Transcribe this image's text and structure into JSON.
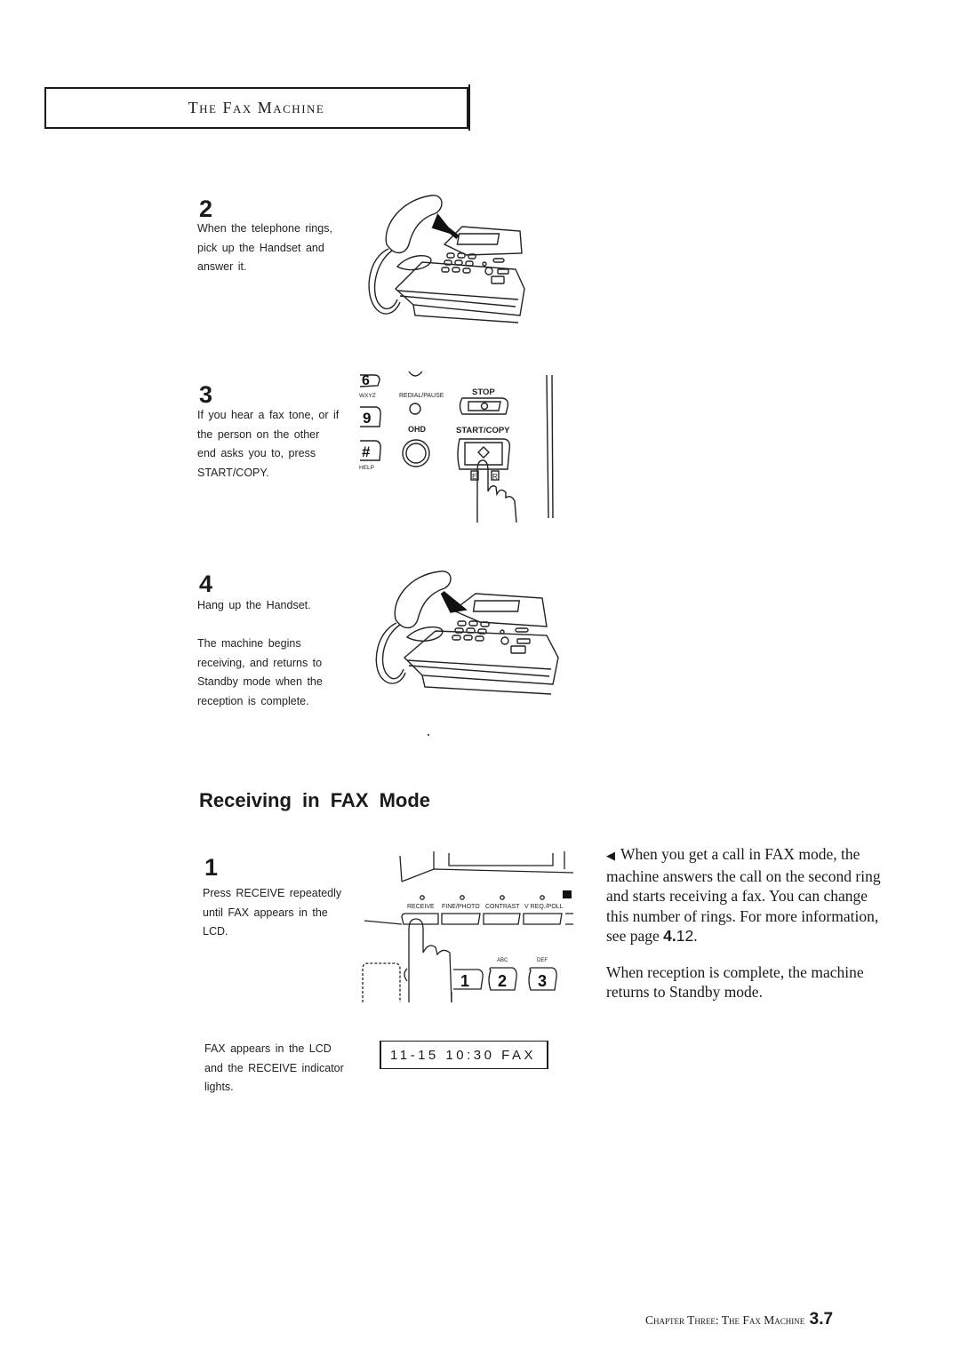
{
  "header": {
    "title": "The Fax Machine"
  },
  "steps_top": [
    {
      "number": "2",
      "lines": [
        "When the telephone rings,",
        "pick up the Handset and",
        "answer it."
      ]
    },
    {
      "number": "3",
      "lines": [
        "If you hear a fax tone, or if",
        "the person on the other",
        "end asks you to, press",
        "START/COPY."
      ]
    },
    {
      "number": "4",
      "lines": [
        "Hang up the Handset.",
        "",
        "The machine begins",
        "receiving, and returns to",
        "Standby mode when the",
        "reception is complete."
      ]
    }
  ],
  "panel_step3": {
    "key_6": "6",
    "key_9": "9",
    "key_hash": "#",
    "wxyz_label": "WXYZ",
    "help_label": "HELP",
    "redial_label": "REDIAL/PAUSE",
    "ohd_label": "OHD",
    "stop_label": "STOP",
    "start_copy_label": "START/COPY",
    "e_label": "E",
    "r_label": "R"
  },
  "section": {
    "title": "Receiving in FAX Mode",
    "step": {
      "number": "1",
      "lines": [
        "Press RECEIVE repeatedly",
        "until FAX appears in the",
        "LCD."
      ]
    },
    "panel": {
      "buttons": [
        "RECEIVE",
        "FINE/PHOTO",
        "CONTRAST",
        "V REQ./POLL"
      ],
      "key_1": "1",
      "key_2": "2",
      "key_3": "3",
      "abc_label": "ABC",
      "def_label": "DEF"
    },
    "lcd_caption": [
      "FAX appears in the LCD",
      "and the RECEIVE indicator",
      "lights."
    ],
    "lcd_text": "11-15 10:30 FAX",
    "note": {
      "para1_a": "When you get a call in FAX mode, the machine answers the call on the second ring and starts receiving a fax. You can change this number of rings. For more information, see page ",
      "para1_page_bold": "4.",
      "para1_page_rest": "12",
      "para1_end": ".",
      "para2": "When reception is complete, the machine returns to Standby mode."
    }
  },
  "footer": {
    "chapter": "Chapter Three: The Fax Machine",
    "page": "3.7"
  }
}
